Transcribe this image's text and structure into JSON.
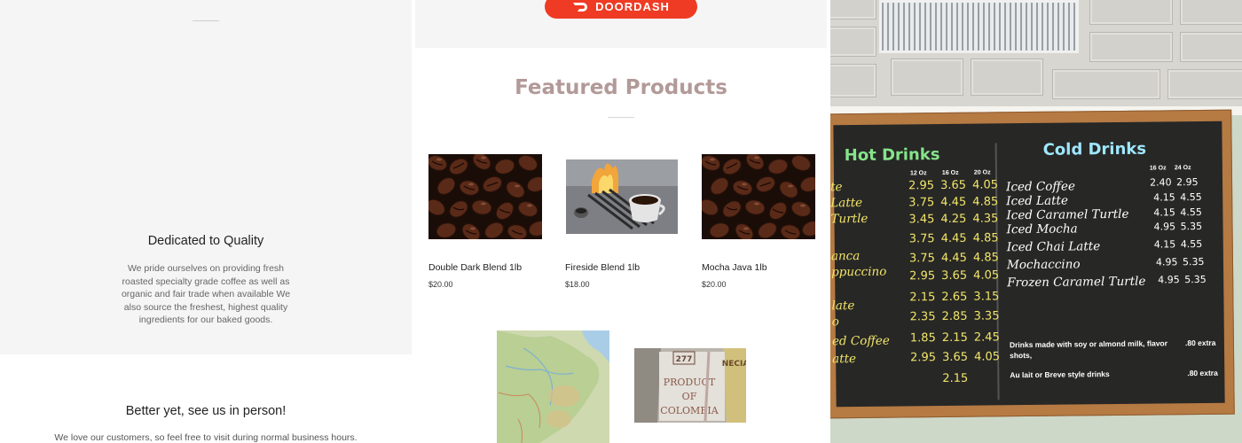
{
  "left": {
    "quality_title": "Dedicated to Quality",
    "quality_text": "We pride ourselves on providing fresh roasted specialty grade coffee as well as organic and fair trade when available We also source the freshest, highest quality ingredients for our baked goods.",
    "person_title": "Better yet, see us in person!",
    "person_text": "We love our customers, so feel free to visit during normal business hours."
  },
  "middle": {
    "doordash_label": "DOORDASH",
    "featured_title": "Featured Products",
    "products": [
      {
        "name": "Double Dark Blend 1lb",
        "price": "$20.00",
        "image": "coffee-beans"
      },
      {
        "name": "Fireside Blend 1lb",
        "price": "$18.00",
        "image": "fireside-cup"
      },
      {
        "name": "Mocha Java 1lb",
        "price": "$20.00",
        "image": "coffee-beans"
      }
    ],
    "extra_images": [
      "brazil-map",
      "colombia-coffee-sack"
    ],
    "sack_text": {
      "number": "277",
      "word1": "PRODUCT",
      "word2": "OF",
      "word3": "COLOMBIA",
      "corner": "NECIA"
    }
  },
  "menu_board": {
    "hot_title": "Hot Drinks",
    "cold_title": "Cold Drinks",
    "hot_sizes": [
      "12 Oz",
      "16 Oz",
      "20 Oz"
    ],
    "cold_sizes": [
      "16 Oz",
      "24 Oz"
    ],
    "hot_partial_names": [
      "te",
      "Latte",
      "Turtle",
      "",
      "anca",
      "ppuccino",
      "",
      "late",
      "o",
      "ed Coffee",
      "atte"
    ],
    "hot_prices": [
      [
        "2.95",
        "3.65",
        "4.05"
      ],
      [
        "3.75",
        "4.45",
        "4.85"
      ],
      [
        "3.45",
        "4.25",
        "4.35"
      ],
      [
        "3.75",
        "4.45",
        "4.85"
      ],
      [
        "3.75",
        "4.45",
        "4.85"
      ],
      [
        "2.95",
        "3.65",
        "4.05"
      ],
      [
        "2.15",
        "2.65",
        "3.15"
      ],
      [
        "2.35",
        "2.85",
        "3.35"
      ],
      [
        "1.85",
        "2.15",
        "2.45"
      ],
      [
        "2.95",
        "3.65",
        "4.05"
      ],
      [
        "",
        "2.15",
        ""
      ]
    ],
    "cold_items": [
      {
        "name": "Iced Coffee",
        "p16": "2.40",
        "p24": "2.95"
      },
      {
        "name": "Iced Latte",
        "p16": "4.15",
        "p24": "4.55"
      },
      {
        "name": "Iced Caramel Turtle",
        "p16": "4.15",
        "p24": "4.55"
      },
      {
        "name": "Iced Mocha",
        "p16": "4.95",
        "p24": "5.35"
      },
      {
        "name": "Iced Chai Latte",
        "p16": "4.15",
        "p24": "4.55"
      },
      {
        "name": "Mochaccino",
        "p16": "4.95",
        "p24": "5.35"
      },
      {
        "name": "Frozen Caramel Turtle",
        "p16": "4.95",
        "p24": "5.35"
      }
    ],
    "notes": [
      {
        "text": "Drinks made with soy or almond milk, flavor shots,",
        "price": ".80 extra"
      },
      {
        "text": "Au lait or Breve style drinks",
        "price": ".80 extra"
      }
    ]
  }
}
